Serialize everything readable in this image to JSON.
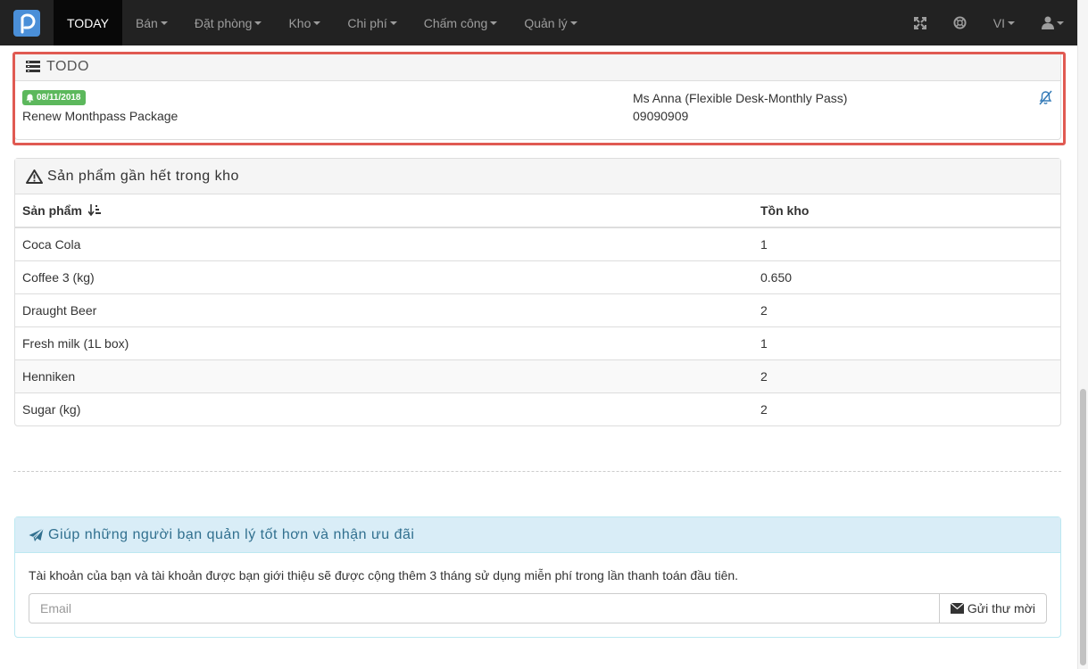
{
  "nav": {
    "today": "TODAY",
    "items": [
      "Bán",
      "Đặt phòng",
      "Kho",
      "Chi phí",
      "Chấm công",
      "Quản lý"
    ],
    "language": "VI"
  },
  "todo": {
    "title": "TODO",
    "badge_date": "08/11/2018",
    "task": "Renew Monthpass Package",
    "customer": "Ms Anna (Flexible Desk-Monthly Pass)",
    "phone": "09090909"
  },
  "stock": {
    "title": "Sản phẩm gần hết trong kho",
    "headers": [
      "Sản phẩm",
      "Tồn kho"
    ],
    "rows": [
      {
        "name": "Coca Cola",
        "qty": "1"
      },
      {
        "name": "Coffee 3 (kg)",
        "qty": "0.650"
      },
      {
        "name": "Draught Beer",
        "qty": "2"
      },
      {
        "name": "Fresh milk (1L box)",
        "qty": "1"
      },
      {
        "name": "Henniken",
        "qty": "2"
      },
      {
        "name": "Sugar (kg)",
        "qty": "2"
      }
    ]
  },
  "referral": {
    "title": "Giúp những người bạn quản lý tốt hơn và nhận ưu đãi",
    "text": "Tài khoản của bạn và tài khoản được bạn giới thiệu sẽ được cộng thêm 3 tháng sử dụng miễn phí trong lần thanh toán đầu tiên.",
    "email_placeholder": "Email",
    "button": "Gửi thư mời"
  },
  "colors": {
    "navbar": "#222222",
    "brand": "#4a8fd8",
    "badge": "#5cb85c",
    "highlight": "#e05a52",
    "info": "#31708f"
  }
}
